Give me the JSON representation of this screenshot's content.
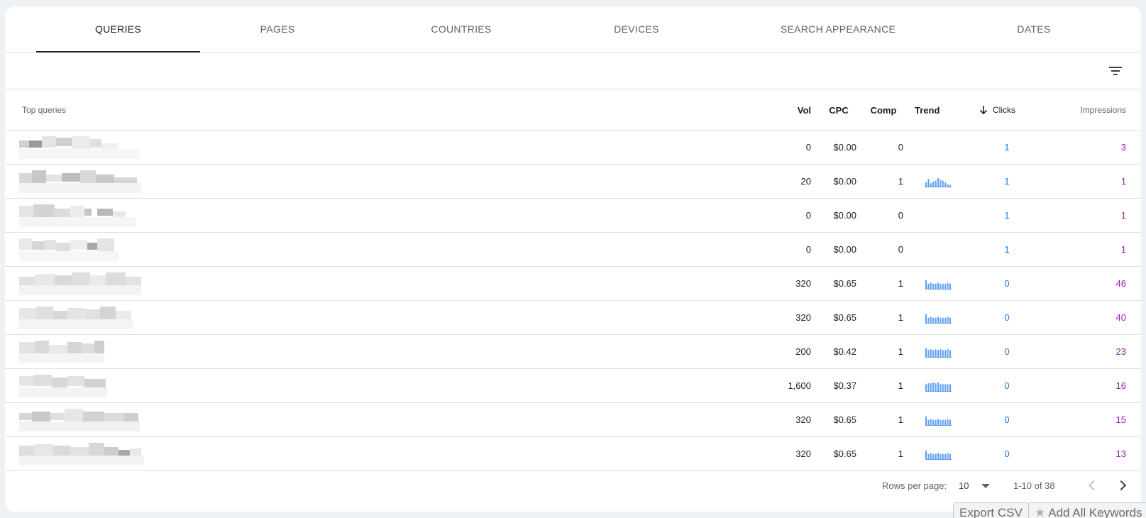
{
  "tabs": [
    {
      "label": "QUERIES",
      "active": true
    },
    {
      "label": "PAGES",
      "active": false
    },
    {
      "label": "COUNTRIES",
      "active": false
    },
    {
      "label": "DEVICES",
      "active": false
    },
    {
      "label": "SEARCH APPEARANCE",
      "active": false
    },
    {
      "label": "DATES",
      "active": false
    }
  ],
  "filter": {
    "icon": "filter-list-icon"
  },
  "table": {
    "headers": {
      "query": "Top queries",
      "vol": "Vol",
      "cpc": "CPC",
      "comp": "Comp",
      "trend": "Trend",
      "clicks": "Clicks",
      "impressions": "Impressions"
    },
    "sort_icon": "arrow-down-icon",
    "rows": [
      {
        "vol": "0",
        "cpc": "$0.00",
        "comp": "0",
        "trend": [],
        "clicks": "1",
        "impressions": "3"
      },
      {
        "vol": "20",
        "cpc": "$0.00",
        "comp": "1",
        "trend": [
          5,
          9,
          4,
          6,
          7,
          10,
          8,
          7,
          5,
          3,
          2
        ],
        "clicks": "1",
        "impressions": "1"
      },
      {
        "vol": "0",
        "cpc": "$0.00",
        "comp": "0",
        "trend": [],
        "clicks": "1",
        "impressions": "1"
      },
      {
        "vol": "0",
        "cpc": "$0.00",
        "comp": "0",
        "trend": [],
        "clicks": "1",
        "impressions": "1"
      },
      {
        "vol": "320",
        "cpc": "$0.65",
        "comp": "1",
        "trend": [
          10,
          6,
          7,
          6,
          6,
          7,
          6,
          6,
          6,
          7,
          6
        ],
        "clicks": "0",
        "impressions": "46"
      },
      {
        "vol": "320",
        "cpc": "$0.65",
        "comp": "1",
        "trend": [
          10,
          6,
          7,
          6,
          6,
          7,
          6,
          6,
          6,
          7,
          6
        ],
        "clicks": "0",
        "impressions": "40"
      },
      {
        "vol": "200",
        "cpc": "$0.42",
        "comp": "1",
        "trend": [
          10,
          8,
          9,
          8,
          9,
          8,
          9,
          8,
          8,
          9,
          8
        ],
        "clicks": "0",
        "impressions": "23"
      },
      {
        "vol": "1,600",
        "cpc": "$0.37",
        "comp": "1",
        "trend": [
          8,
          9,
          9,
          10,
          9,
          10,
          8,
          8,
          8,
          8,
          8
        ],
        "clicks": "0",
        "impressions": "16"
      },
      {
        "vol": "320",
        "cpc": "$0.65",
        "comp": "1",
        "trend": [
          10,
          6,
          7,
          6,
          6,
          7,
          6,
          6,
          6,
          7,
          6
        ],
        "clicks": "0",
        "impressions": "15"
      },
      {
        "vol": "320",
        "cpc": "$0.65",
        "comp": "1",
        "trend": [
          10,
          6,
          7,
          6,
          6,
          7,
          6,
          6,
          6,
          7,
          6
        ],
        "clicks": "0",
        "impressions": "13"
      }
    ]
  },
  "pagination": {
    "rows_per_page_label": "Rows per page:",
    "rows_per_page_value": "10",
    "range": "1-10 of 38"
  },
  "buttons": {
    "export": "Export CSV",
    "add_keywords": "Add All Keywords"
  },
  "colors": {
    "clicks": "#1a73e8",
    "impressions": "#8e24aa",
    "trend_bars": "#5b9cf2"
  }
}
